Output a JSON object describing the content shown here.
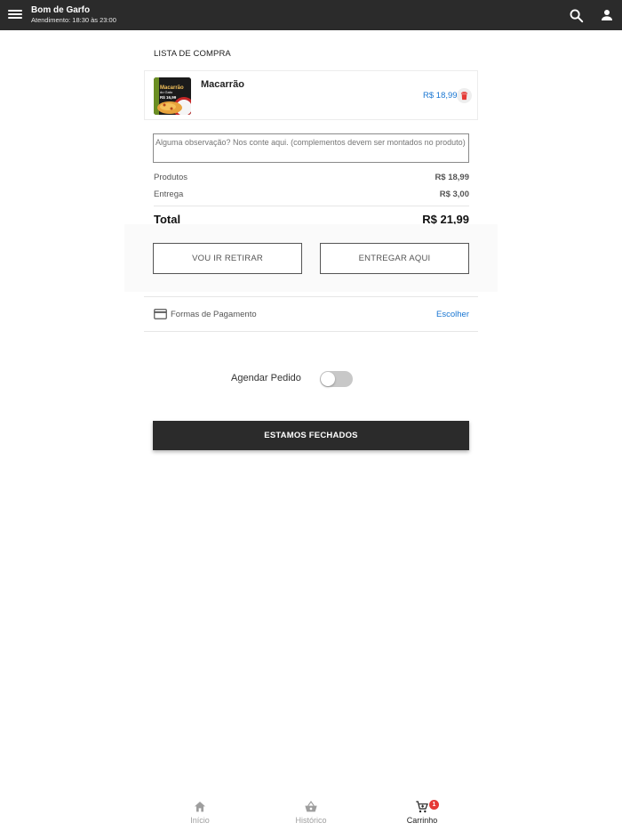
{
  "appbar": {
    "title": "Bom de Garfo",
    "subtitle": "Atendimento: 18:30 às 23:00",
    "menu_icon": "menu-icon",
    "search_icon": "search-icon",
    "account_icon": "person-icon"
  },
  "cart": {
    "section_title": "LISTA DE COMPRA",
    "items": [
      {
        "name": "Macarrão",
        "price": "R$ 18,99",
        "thumb_title": "Macarrão",
        "thumb_subtitle": "do Gato",
        "thumb_price": "R$ 16,99"
      }
    ],
    "note_placeholder": "Alguma observação? Nos conte aqui. (complementos devem ser montados no produto)"
  },
  "summary": {
    "products_label": "Produtos",
    "products_value": "R$ 18,99",
    "delivery_label": "Entrega",
    "delivery_value": "R$ 3,00",
    "total_label": "Total",
    "total_value": "R$ 21,99"
  },
  "delivery_options": {
    "pickup_label": "VOU IR RETIRAR",
    "deliver_label": "ENTREGAR AQUI"
  },
  "payment": {
    "label": "Formas de Pagamento",
    "action": "Escolher",
    "icon": "credit-card-icon"
  },
  "schedule": {
    "label": "Agendar Pedido",
    "enabled": false
  },
  "checkout": {
    "label": "ESTAMOS FECHADOS"
  },
  "bottom_nav": {
    "items": [
      {
        "label": "Início",
        "icon": "home-icon"
      },
      {
        "label": "Histórico",
        "icon": "basket-icon"
      },
      {
        "label": "Carrinho",
        "icon": "cart-icon",
        "badge": "1"
      }
    ]
  },
  "colors": {
    "appbar": "#2b2b2b",
    "link": "#1976d2",
    "badge": "#e53935",
    "delete": "#e53935"
  }
}
